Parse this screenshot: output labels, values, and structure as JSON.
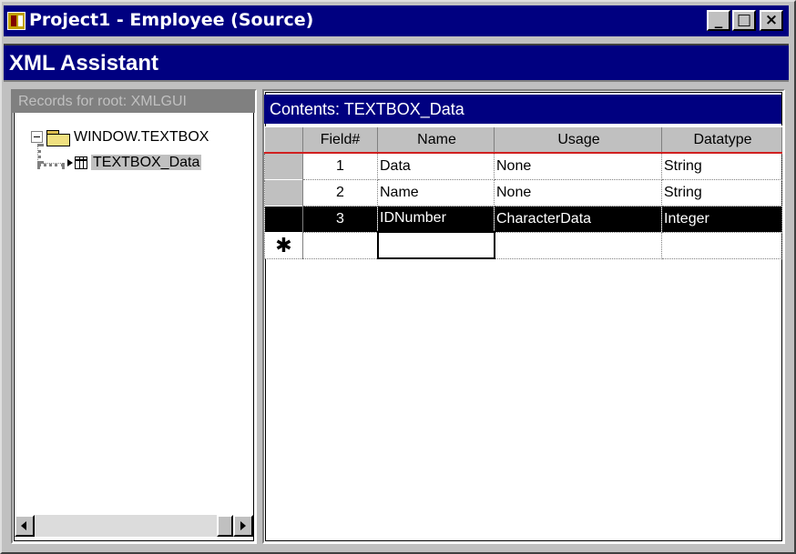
{
  "window": {
    "title": "Project1 - Employee (Source)",
    "minimize_glyph": "_",
    "maximize_glyph": "□",
    "close_glyph": "×"
  },
  "assistant": {
    "title": "XML Assistant"
  },
  "left_pane": {
    "header": "Records for root: XMLGUI",
    "tree": [
      {
        "label": "WINDOW.TEXTBOX",
        "icon": "folder-icon",
        "expanded": true
      },
      {
        "label": "TEXTBOX_Data",
        "icon": "table-icon",
        "selected": true
      }
    ]
  },
  "right_pane": {
    "header": "Contents: TEXTBOX_Data",
    "columns": [
      "Field#",
      "Name",
      "Usage",
      "Datatype"
    ],
    "rows": [
      {
        "field": "1",
        "name": "Data",
        "usage": "None",
        "datatype": "String"
      },
      {
        "field": "2",
        "name": "Name",
        "usage": "None",
        "datatype": "String"
      },
      {
        "field": "3",
        "name": "IDNumber",
        "usage": "CharacterData",
        "datatype": "Integer"
      }
    ],
    "new_row_marker": "✱"
  },
  "colors": {
    "titlebar": "#000080",
    "face": "#c0c0c0",
    "selection": "#000000"
  }
}
